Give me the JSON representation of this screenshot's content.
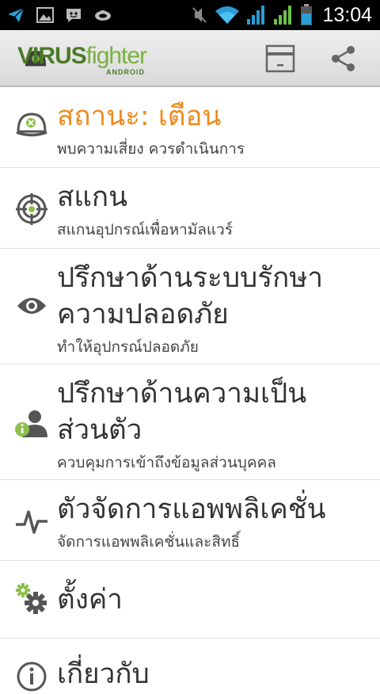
{
  "status_bar": {
    "time": "13:04",
    "left_icons": [
      "telegram-icon",
      "image-icon",
      "messenger-icon",
      "spy-icon"
    ],
    "right_icons": [
      "mute-icon",
      "wifi-icon",
      "signal-icon",
      "signal-icon",
      "battery-icon"
    ]
  },
  "action_bar": {
    "logo_virus": "VIRUS",
    "logo_fighter": "fighter",
    "logo_sub": "ANDROID",
    "actions": [
      "card-icon",
      "share-icon"
    ]
  },
  "menu": {
    "items": [
      {
        "title": "สถานะ: เตือน",
        "subtitle": "พบความเสี่ยง ควรดำเนินการ",
        "icon": "helmet-icon"
      },
      {
        "title": "สแกน",
        "subtitle": "สแกนอุปกรณ์เพื่อหามัลแวร์",
        "icon": "target-icon"
      },
      {
        "title": "ปรึกษาด้านระบบรักษาความปลอดภัย",
        "subtitle": "ทำให้อุปกรณ์ปลอดภัย",
        "icon": "eye-icon"
      },
      {
        "title": "ปรึกษาด้านความเป็นส่วนตัว",
        "subtitle": "ควบคุมการเข้าถึงข้อมูลส่วนบุคคล",
        "icon": "person-info-icon"
      },
      {
        "title": "ตัวจัดการแอพพลิเคชั่น",
        "subtitle": "จัดการแอพพลิเคชั่นและสิทธิ์",
        "icon": "pulse-icon"
      },
      {
        "title": "ตั้งค่า",
        "subtitle": "",
        "icon": "settings-icon"
      },
      {
        "title": "เกี่ยวกับ",
        "subtitle": "",
        "icon": "info-icon"
      }
    ]
  },
  "colors": {
    "status_title": "#f08a1c",
    "accent_green": "#7ab040",
    "text": "#333333"
  }
}
